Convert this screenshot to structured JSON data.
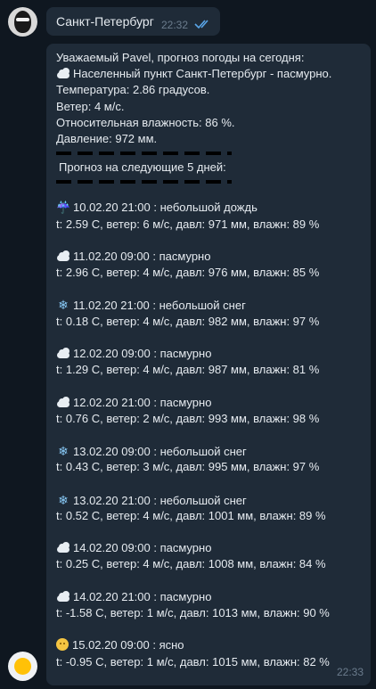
{
  "header": {
    "title": "Санкт-Петербург",
    "time": "22:32"
  },
  "message": {
    "greeting": "Уважаемый Pavel, прогноз погоды на сегодня:",
    "current": "Населенный пункт Санкт-Петербург - пасмурно.",
    "temperature": "Температура: 2.86 градусов.",
    "wind": "Ветер: 4 м/с.",
    "humidity": "Относительная влажность: 86 %.",
    "pressure": "Давление: 972 мм.",
    "forecast_title": "Прогноз на следующие 5 дней:",
    "time": "22:33"
  },
  "forecast": [
    {
      "icon": "rain-icon",
      "title": "10.02.20 21:00 : небольшой дождь",
      "details": "t: 2.59 С, ветер: 6 м/с, давл: 971 мм, влажн: 89 %"
    },
    {
      "icon": "cloud-icon",
      "title": "11.02.20 09:00 : пасмурно",
      "details": "t: 2.96 С, ветер: 4 м/с, давл: 976 мм, влажн: 85 %"
    },
    {
      "icon": "snow-icon",
      "title": "11.02.20 21:00 : небольшой снег",
      "details": "t: 0.18 С, ветер: 4 м/с, давл: 982 мм, влажн: 97 %"
    },
    {
      "icon": "cloud-icon",
      "title": "12.02.20 09:00 : пасмурно",
      "details": "t: 1.29 С, ветер: 4 м/с, давл: 987 мм, влажн: 81 %"
    },
    {
      "icon": "cloud-icon",
      "title": "12.02.20 21:00 : пасмурно",
      "details": "t: 0.76 С, ветер: 2 м/с, давл: 993 мм, влажн: 98 %"
    },
    {
      "icon": "snow-icon",
      "title": "13.02.20 09:00 : небольшой снег",
      "details": "t: 0.43 С, ветер: 3 м/с, давл: 995 мм, влажн: 97 %"
    },
    {
      "icon": "snow-icon",
      "title": "13.02.20 21:00 : небольшой снег",
      "details": "t: 0.52 С, ветер: 4 м/с, давл: 1001 мм, влажн: 89 %"
    },
    {
      "icon": "cloud-icon",
      "title": "14.02.20 09:00 : пасмурно",
      "details": "t: 0.25 С, ветер: 4 м/с, давл: 1008 мм, влажн: 84 %"
    },
    {
      "icon": "cloud-icon",
      "title": "14.02.20 21:00 : пасмурно",
      "details": "t: -1.58 С, ветер: 1 м/с, давл: 1013 мм, влажн: 90 %"
    },
    {
      "icon": "sun-icon",
      "title": "15.02.20 09:00 : ясно",
      "details": "t: -0.95 С, ветер: 1 м/с, давл: 1015 мм, влажн: 82 %"
    }
  ]
}
